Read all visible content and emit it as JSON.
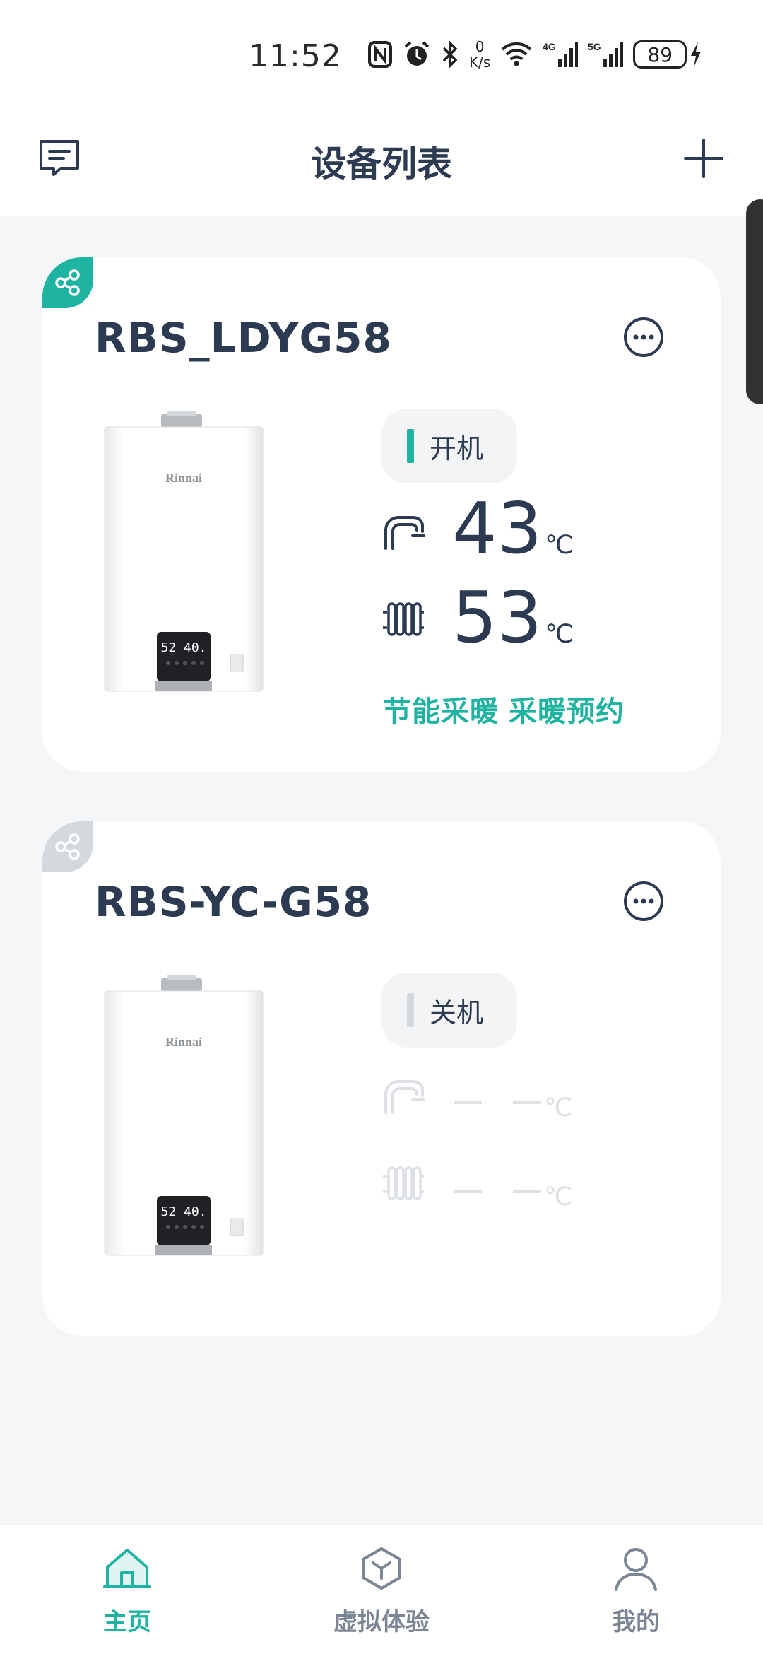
{
  "status_bar": {
    "time": "11:52",
    "net_speed_value": "0",
    "net_speed_unit": "K/s",
    "battery": "89",
    "signal_a": "4G",
    "signal_b": "5G"
  },
  "header": {
    "title": "设备列表",
    "message_icon": "message-icon",
    "add_icon": "plus-icon"
  },
  "devices": [
    {
      "name": "RBS_LDYG58",
      "shared_badge": "share-icon",
      "power_status": "开机",
      "hot_water_temp": "43",
      "heating_temp": "53",
      "unit": "℃",
      "features": [
        "节能采暖",
        "采暖预约"
      ],
      "heater_display": "52 40.",
      "brand": "Rinnai"
    },
    {
      "name": "RBS-YC-G58",
      "shared_badge": "share-icon",
      "power_status": "关机",
      "unit": "℃",
      "heater_display": "52 40.",
      "brand": "Rinnai"
    }
  ],
  "bottom_nav": {
    "items": [
      {
        "label": "主页",
        "icon": "home-icon",
        "active": true
      },
      {
        "label": "虚拟体验",
        "icon": "cube-icon",
        "active": false
      },
      {
        "label": "我的",
        "icon": "user-icon",
        "active": false
      }
    ]
  },
  "colors": {
    "accent": "#1fb3a1",
    "text": "#2c3a52",
    "inactive": "#7c8594",
    "disabled": "#dde1e6",
    "background": "#f5f6f7"
  }
}
